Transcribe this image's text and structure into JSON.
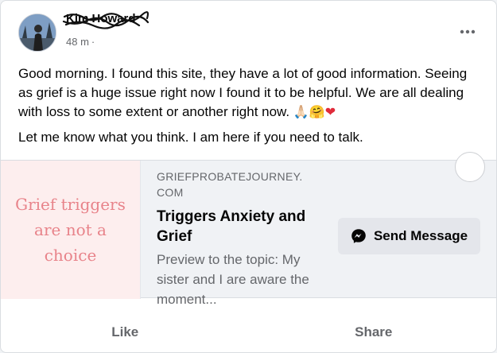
{
  "post": {
    "author": "Kim Howard",
    "timestamp": "48 m",
    "separator": "·",
    "more_icon": "more-horizontal-icon",
    "text_paragraph_1": "Good morning. I found this site, they have a lot of good information. Seeing as grief is a huge issue right now I found it to be helpful. We are all dealing with loss to some extent or another right now.",
    "emoji": [
      "🙏🏻",
      "🤗",
      "❤"
    ],
    "text_paragraph_2": "Let me know what you think. I am here if you need to talk."
  },
  "link_preview": {
    "thumbnail_text": "Grief triggers\nare not a\nchoice",
    "domain": "GRIEFPROBATEJOURNEY.\nCOM",
    "title": "Triggers Anxiety and Grief",
    "description": "Preview to the topic: My sister and I are aware the moment...",
    "send_button_label": "Send Message",
    "send_icon": "messenger-icon"
  },
  "actions": {
    "like_label": "Like",
    "share_label": "Share"
  },
  "colors": {
    "messenger_blue": "#1877f2",
    "thumbnail_text": "#e8838a",
    "secondary_text": "#65676b"
  }
}
